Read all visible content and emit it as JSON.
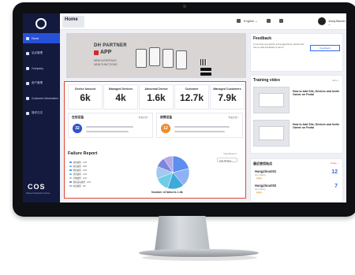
{
  "header": {
    "tab": "Home",
    "language": "English ⌄",
    "user": "Jenny Bischer ⌄"
  },
  "sidebar": {
    "items": [
      {
        "label": "Home",
        "icon": "home-icon"
      },
      {
        "label": "站点管理",
        "icon": "location-icon"
      },
      {
        "label": "Company",
        "icon": "company-icon"
      },
      {
        "label": "用户管理",
        "icon": "users-icon"
      },
      {
        "label": "Customer Information",
        "icon": "customer-icon"
      },
      {
        "label": "操作日志",
        "icon": "log-icon"
      }
    ],
    "brand": "COS",
    "brand_sub": "Dahua Configuration Service"
  },
  "banner": {
    "title": "DH PARTNER",
    "app": "APP",
    "line1": "NEW INTERFACE",
    "line2": "NEW FUNCTIONS"
  },
  "kpis": [
    {
      "label": "Device Amount",
      "value": "6k"
    },
    {
      "label": "Managed Devices",
      "value": "4k"
    },
    {
      "label": "Abnormal Device",
      "value": "1.6k"
    },
    {
      "label": "Customer",
      "value": "12.7k"
    },
    {
      "label": "Managed Customers",
      "value": "7.9k"
    }
  ],
  "panels": {
    "left": {
      "title": "在线设备",
      "more": "查看全部 >",
      "count": "32"
    },
    "right": {
      "title": "故障设备",
      "more": "查看全部 >",
      "count": "12"
    }
  },
  "failure": {
    "title": "Failure Report",
    "more": "View Report >",
    "select": "Last 30 days ⌄",
    "caption": "Number of failures",
    "total": "1.8k",
    "legend": [
      {
        "label": "其他故障",
        "value": "21%",
        "color": "#5b8ff0"
      },
      {
        "label": "硬盘故障",
        "value": "18%",
        "color": "#8fb2f5"
      },
      {
        "label": "网络故障",
        "value": "16%",
        "color": "#3fa9d8"
      },
      {
        "label": "通道故障",
        "value": "14%",
        "color": "#6fcde8"
      },
      {
        "label": "录像故障",
        "value": "12%",
        "color": "#a3c7f0"
      },
      {
        "label": "视频丢失故障",
        "value": "10%",
        "color": "#7c86d9"
      },
      {
        "label": "电源故障",
        "value": "9%",
        "color": "#b6a8e6"
      }
    ]
  },
  "feedback": {
    "title": "Feedback",
    "text": "If you have any advice and suggestions, please feel free to click Feedback to tell us.",
    "button": "Feedback"
  },
  "training": {
    "title": "Training video",
    "more": "More >",
    "videos": [
      {
        "caption": "How to Add Site, Devices and Invite Owner on Portal"
      },
      {
        "caption": "How to Add Site, Devices and Invite Owner on Portal"
      }
    ]
  },
  "sites": {
    "title": "最近使用站点",
    "today": "Today ⌄",
    "items": [
      {
        "name": "Hangzhou001",
        "count": "12",
        "owner": "Jerry Zhang",
        "status": "Active"
      },
      {
        "name": "Hangzhou002",
        "count": "7",
        "owner": "Jerry Zhang",
        "status": "Active"
      }
    ]
  },
  "colors": {
    "sidebar": "#131a3d",
    "accent": "#2750d8",
    "highlight": "#e04a3a"
  }
}
